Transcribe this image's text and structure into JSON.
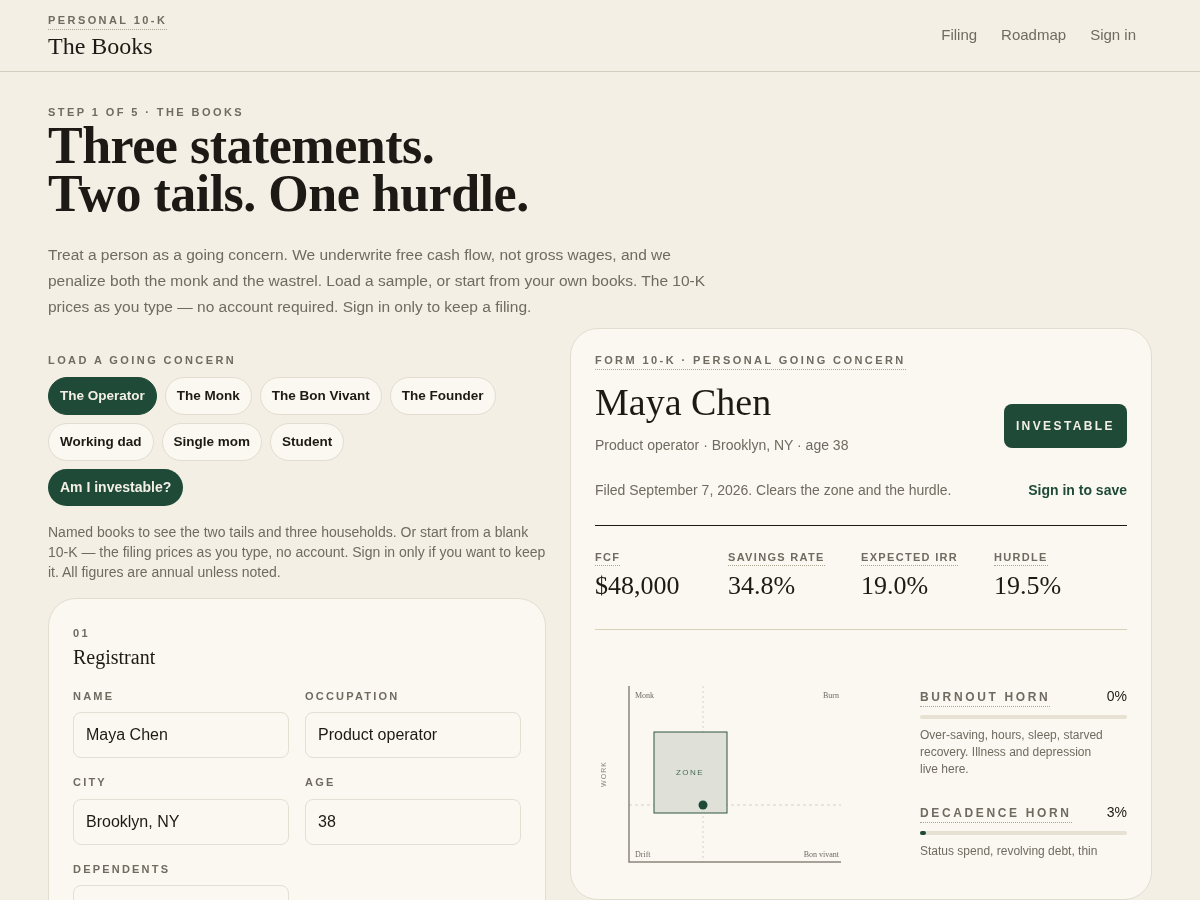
{
  "brand": {
    "eyebrow": "PERSONAL 10-K",
    "title": "The Books"
  },
  "nav": [
    {
      "label": "Filing"
    },
    {
      "label": "Roadmap"
    },
    {
      "label": "Sign in"
    }
  ],
  "hero": {
    "step": "STEP 1 OF 5 · THE BOOKS",
    "headline": [
      "Three statements.",
      "Two tails. One hurdle."
    ],
    "intro": "Treat a person as a going concern. We underwrite free cash flow, not gross wages, and we penalize both the monk and the wastrel. Load a sample, or start from your own books. The 10-K prices as you type — no account required. Sign in only to keep a filing."
  },
  "samples": {
    "label": "LOAD A GOING CONCERN",
    "chips": [
      {
        "label": "The Operator",
        "selected": true
      },
      {
        "label": "The Monk",
        "selected": false
      },
      {
        "label": "The Bon Vivant",
        "selected": false
      },
      {
        "label": "The Founder",
        "selected": false
      },
      {
        "label": "Working dad",
        "selected": false
      },
      {
        "label": "Single mom",
        "selected": false
      },
      {
        "label": "Student",
        "selected": false
      }
    ],
    "cta": "Am I investable?",
    "note": "Named books to see the two tails and three households. Or start from a blank 10-K — the filing prices as you type, no account. Sign in only if you want to keep it. All figures are annual unless noted."
  },
  "registrant": {
    "number": "01",
    "title": "Registrant",
    "fields": [
      {
        "label": "NAME",
        "value": "Maya Chen"
      },
      {
        "label": "OCCUPATION",
        "value": "Product operator"
      },
      {
        "label": "CITY",
        "value": "Brooklyn, NY"
      },
      {
        "label": "AGE",
        "value": "38"
      },
      {
        "label": "DEPENDENTS"
      }
    ]
  },
  "filing": {
    "eyebrow": "FORM 10-K · PERSONAL GOING CONCERN",
    "name": "Maya Chen",
    "subtitle": "Product operator · Brooklyn, NY · age 38",
    "verdict": "INVESTABLE",
    "filed": "Filed September 7, 2026. Clears the zone and the hurdle.",
    "save_link": "Sign in to save",
    "metrics": [
      {
        "label": "FCF",
        "value": "$48,000"
      },
      {
        "label": "SAVINGS RATE",
        "value": "34.8%"
      },
      {
        "label": "EXPECTED IRR",
        "value": "19.0%"
      },
      {
        "label": "HURDLE",
        "value": "19.5%"
      }
    ],
    "quadrant": {
      "axis_label": "WORK",
      "corners": [
        "Monk",
        "Burn",
        "Drift",
        "Bon vivant"
      ],
      "zone_label": "ZONE"
    },
    "horns": [
      {
        "label": "BURNOUT HORN",
        "reading": "0%",
        "level": 0,
        "text": "Over-saving, hours, sleep, starved recovery. Illness and depression live here."
      },
      {
        "label": "DECADENCE HORN",
        "reading": "3%",
        "level": 0.03,
        "text": "Status spend, revolving debt, thin"
      }
    ]
  }
}
